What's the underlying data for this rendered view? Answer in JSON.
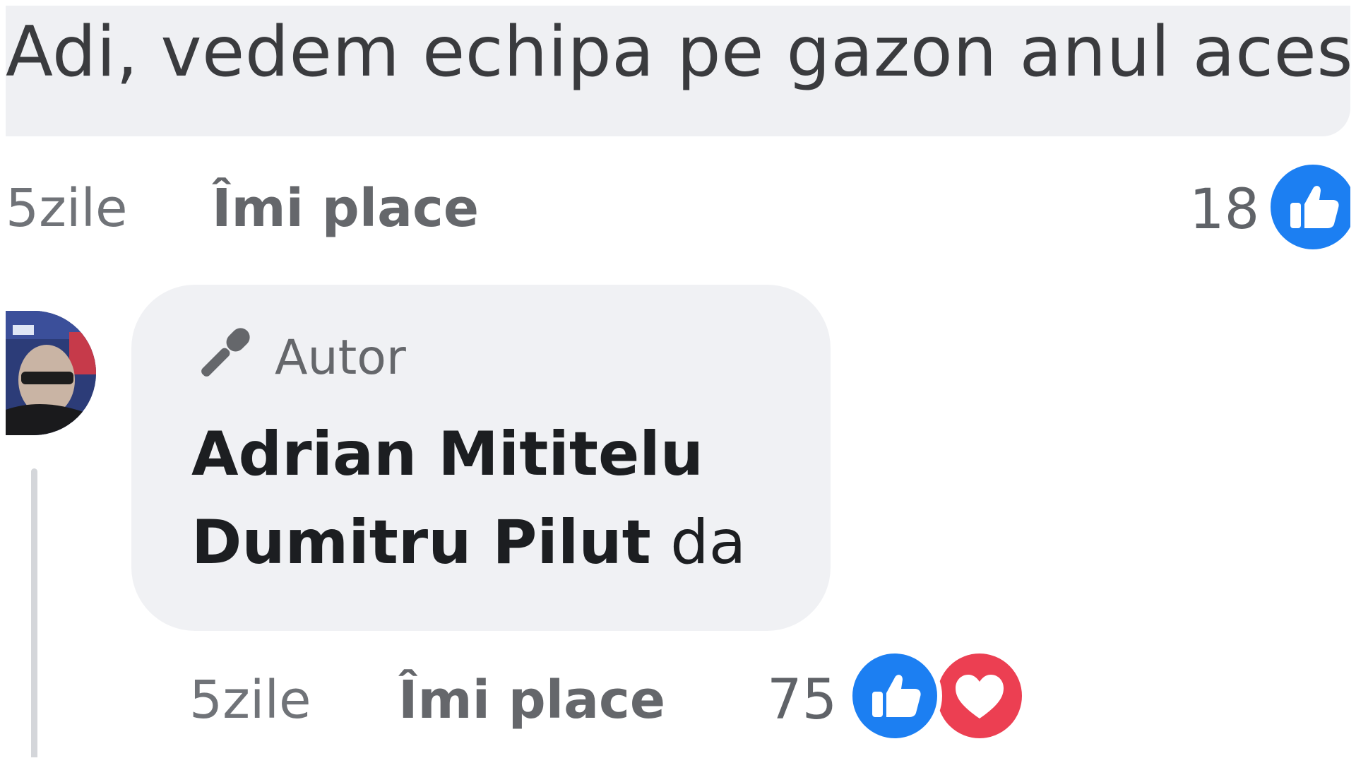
{
  "top_comment": {
    "text": "Adi, vedem echipa pe gazon anul acesta",
    "time": "5zile",
    "like_label": "Îmi place",
    "reaction_count": "18"
  },
  "reply": {
    "badge_label": "Autor",
    "author": "Adrian Mititelu",
    "mention": "Dumitru Pilut",
    "text": "da",
    "time": "5zile",
    "like_label": "Îmi place",
    "reaction_count": "75"
  },
  "icons": {
    "like": "like-icon",
    "love": "heart-icon",
    "author_badge": "microphone-icon"
  },
  "colors": {
    "like_blue": "#1c7ff2",
    "love_red": "#ec3f52",
    "bubble_gray": "#f0f1f4"
  }
}
